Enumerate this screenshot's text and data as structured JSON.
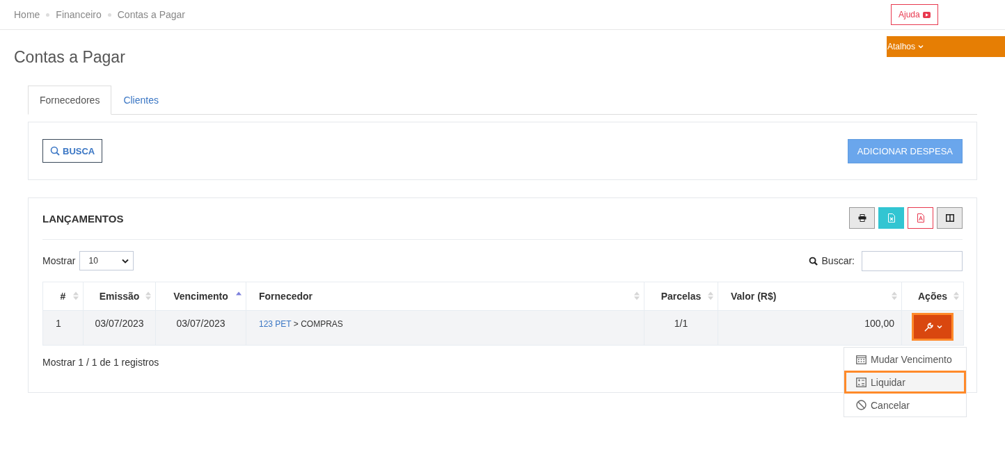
{
  "breadcrumb": [
    "Home",
    "Financeiro",
    "Contas a Pagar"
  ],
  "header_buttons": [
    {
      "label": "Ajuda",
      "kind": "help"
    },
    {
      "label": "Atalhos",
      "kind": "menu"
    }
  ],
  "page_title": "Contas a Pagar",
  "tabs": [
    {
      "label": "Fornecedores",
      "selected": true
    },
    {
      "label": "Clientes",
      "selected": false
    }
  ],
  "search_button": "BUSCA",
  "add_button": "ADICIONAR DESPESA",
  "panel_title": "LANÇAMENTOS",
  "export_buttons": [
    {
      "kind": "print"
    },
    {
      "kind": "excel"
    },
    {
      "kind": "pdf"
    },
    {
      "kind": "columns"
    }
  ],
  "length_label": "Mostrar",
  "length_value": "10",
  "search_label": "Buscar:",
  "columns": [
    {
      "label": "#",
      "sorted": false
    },
    {
      "label": "Emissão",
      "sorted": false
    },
    {
      "label": "Vencimento",
      "sorted": true
    },
    {
      "label": "Fornecedor",
      "sorted": false
    },
    {
      "label": "Parcelas",
      "sorted": false
    },
    {
      "label": "Valor (R$)",
      "sorted": false
    },
    {
      "label": "Ações",
      "sorted": false
    }
  ],
  "rows": [
    {
      "number": "1",
      "emissao": "03/07/2023",
      "vencimento": "03/07/2023",
      "supplier_link": "123 PET",
      "supplier_rest": "> COMPRAS",
      "parcelas": "1/1",
      "valor": "100,00",
      "menu_open": true
    }
  ],
  "actions_menu": [
    {
      "label": "Mudar Vencimento",
      "kind": "calendar",
      "selected": false
    },
    {
      "label": "Liquidar",
      "kind": "list",
      "selected": true
    },
    {
      "label": "Cancelar",
      "kind": "ban",
      "selected": false
    }
  ],
  "info": "Mostrar 1 / 1 de 1 registros"
}
